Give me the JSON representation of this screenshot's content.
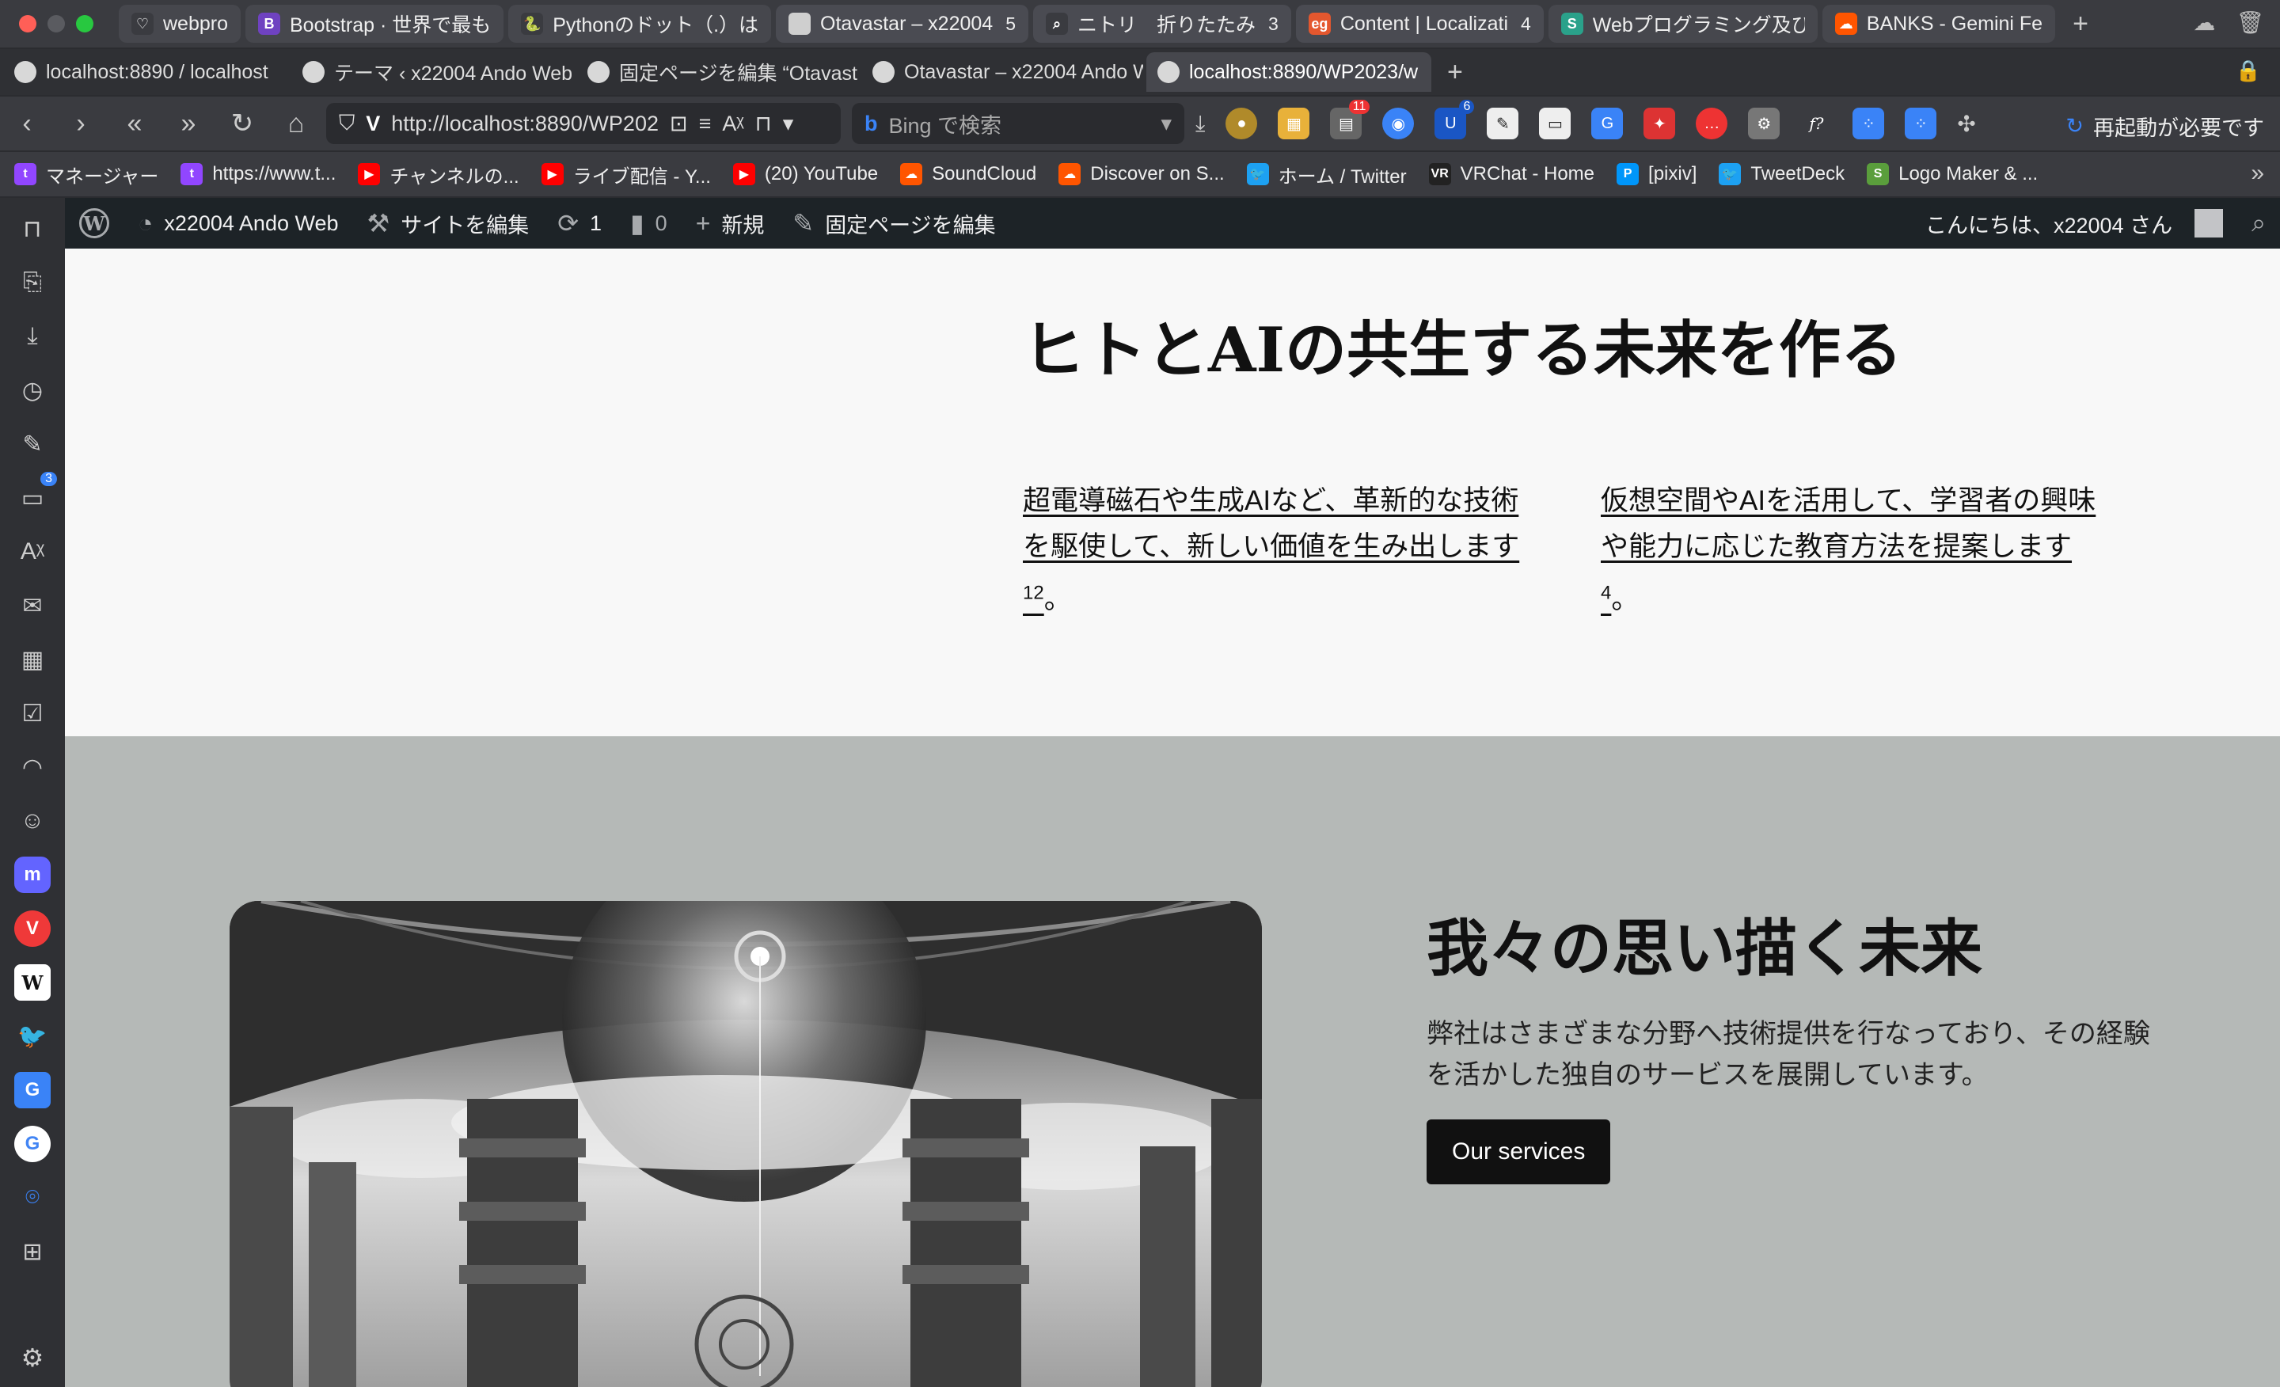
{
  "tabs": [
    {
      "label": "webpro",
      "fav_color": "#3a3b40",
      "fav": "♡"
    },
    {
      "label": "Bootstrap · 世界で最も",
      "fav_color": "#6f42c1",
      "fav": "B"
    },
    {
      "label": "Pythonのドット（.）は",
      "fav_color": "#3a3b40",
      "fav": "🐍"
    },
    {
      "label": "Otavastar – x22004",
      "fav_color": "#cfcfcf",
      "fav": "",
      "count": "5"
    },
    {
      "label": "ニトリ　折りたたみ",
      "fav_color": "#3a3b40",
      "fav": "⌕",
      "count": "3"
    },
    {
      "label": "Content | Localizati",
      "fav_color": "#e4572e",
      "fav": "eg",
      "count": "4"
    },
    {
      "label": "Webプログラミング及び",
      "fav_color": "#2aa18a",
      "fav": "S"
    },
    {
      "label": "BANKS - Gemini Fe",
      "fav_color": "#ff5500",
      "fav": "☁"
    }
  ],
  "tabs2": [
    {
      "label": "localhost:8890 / localhost"
    },
    {
      "label": "テーマ ‹ x22004 Ando Web"
    },
    {
      "label": "固定ページを編集 “Otavast"
    },
    {
      "label": "Otavastar – x22004 Ando W"
    },
    {
      "label": "localhost:8890/WP2023/w"
    }
  ],
  "address": {
    "url": "http://localhost:8890/WP202",
    "search_placeholder": "Bing で検索",
    "restart": "再起動が必要です",
    "ext_badge_1": "11",
    "ext_badge_2": "6"
  },
  "bookmarks": [
    {
      "label": "マネージャー",
      "color": "#9146ff",
      "glyph": "t"
    },
    {
      "label": "https://www.t...",
      "color": "#9146ff",
      "glyph": "t"
    },
    {
      "label": "チャンネルの...",
      "color": "#ff0000",
      "glyph": "▶"
    },
    {
      "label": "ライブ配信 - Y...",
      "color": "#ff0000",
      "glyph": "▶"
    },
    {
      "label": "(20) YouTube",
      "color": "#ff0000",
      "glyph": "▶"
    },
    {
      "label": "SoundCloud",
      "color": "#ff5500",
      "glyph": "☁"
    },
    {
      "label": "Discover on S...",
      "color": "#ff5500",
      "glyph": "☁"
    },
    {
      "label": "ホーム / Twitter",
      "color": "#1da1f2",
      "glyph": "🐦"
    },
    {
      "label": "VRChat - Home",
      "color": "#222222",
      "glyph": "VR"
    },
    {
      "label": "[pixiv]",
      "color": "#0096fa",
      "glyph": "P"
    },
    {
      "label": "TweetDeck",
      "color": "#1da1f2",
      "glyph": "🐦"
    },
    {
      "label": "Logo Maker & ...",
      "color": "#5a9e3c",
      "glyph": "S"
    }
  ],
  "sidepanel": {
    "mail_badge": "3"
  },
  "wpbar": {
    "site_name": "x22004 Ando Web",
    "edit_site": "サイトを編集",
    "updates": "1",
    "comments": "0",
    "new": "新規",
    "edit_page": "固定ページを編集",
    "greeting": "こんにちは、x22004 さん"
  },
  "hero": {
    "title": "ヒトとAIの共生する未来を作る",
    "col1_text": "超電導磁石や生成AIなど、革新的な技術を駆使して、新しい価値を生み出します",
    "col1_sup": "12",
    "col1_end": "。",
    "col2_text": "仮想空間やAIを活用して、学習者の興味や能力に応じた教育方法を提案します",
    "col2_sup": "4",
    "col2_end": "。"
  },
  "future": {
    "title": "我々の思い描く未来",
    "text": "弊社はさまざまな分野へ技術提供を行なっており、その経験を活かした独自のサービスを展開しています。",
    "button": "Our services"
  }
}
